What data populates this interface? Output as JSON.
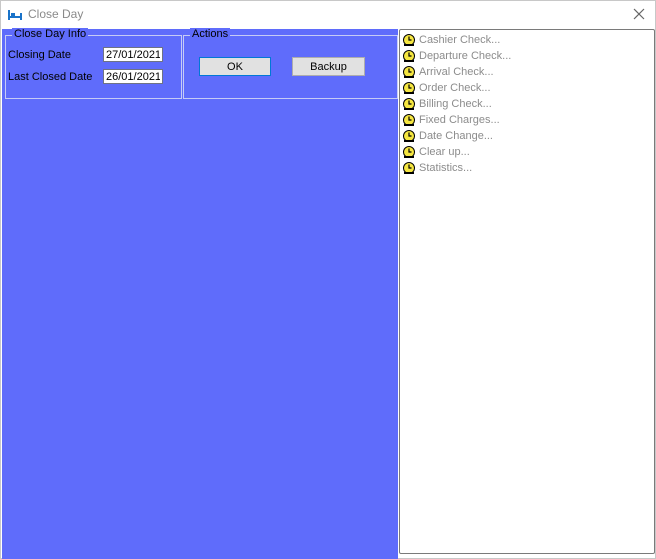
{
  "window": {
    "title": "Close Day",
    "icon": "bed-icon",
    "close_icon": "close-icon"
  },
  "info": {
    "legend": "Close Day Info",
    "closing_date_label": "Closing Date",
    "closing_date_value": "27/01/2021",
    "last_closed_label": "Last Closed Date",
    "last_closed_value": "26/01/2021"
  },
  "actions": {
    "legend": "Actions",
    "ok_label": "OK",
    "backup_label": "Backup"
  },
  "checks": {
    "icon": "clock-icon",
    "items": [
      {
        "label": "Cashier Check..."
      },
      {
        "label": "Departure Check..."
      },
      {
        "label": "Arrival Check..."
      },
      {
        "label": "Order Check..."
      },
      {
        "label": "Billing Check..."
      },
      {
        "label": "Fixed Charges..."
      },
      {
        "label": "Date Change..."
      },
      {
        "label": "Clear up..."
      },
      {
        "label": "Statistics..."
      }
    ]
  },
  "colors": {
    "panel_background": "#5f6cfb",
    "title_text": "#8a8a8a",
    "item_text": "#8c8c8c",
    "ok_focus_border": "#0078d7"
  }
}
